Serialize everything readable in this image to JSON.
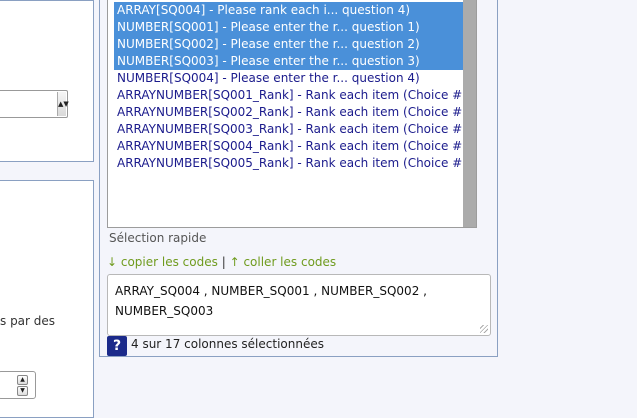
{
  "column_list": {
    "items": [
      {
        "label": "ARRAY[SQ004] - Please rank each i... question 4)",
        "selected": true
      },
      {
        "label": "NUMBER[SQ001] - Please enter the r... question 1)",
        "selected": true
      },
      {
        "label": "NUMBER[SQ002] - Please enter the r... question 2)",
        "selected": true
      },
      {
        "label": "NUMBER[SQ003] - Please enter the r... question 3)",
        "selected": true
      },
      {
        "label": "NUMBER[SQ004] - Please enter the r... question 4)",
        "selected": false
      },
      {
        "label": "ARRAYNUMBER[SQ001_Rank] - Rank each item (Choice #",
        "selected": false
      },
      {
        "label": "ARRAYNUMBER[SQ002_Rank] - Rank each item (Choice #",
        "selected": false
      },
      {
        "label": "ARRAYNUMBER[SQ003_Rank] - Rank each item (Choice #",
        "selected": false
      },
      {
        "label": "ARRAYNUMBER[SQ004_Rank] - Rank each item (Choice #",
        "selected": false
      },
      {
        "label": "ARRAYNUMBER[SQ005_Rank] - Rank each item (Choice #",
        "selected": false
      }
    ]
  },
  "quick_selection": {
    "label": "Sélection rapide",
    "copy_link": "↓ copier les codes",
    "separator": "|",
    "paste_link": "↑ coller les codes",
    "codes_value": "ARRAY_SQ004 , NUMBER_SQ001 , NUMBER_SQ002 , NUMBER_SQ003"
  },
  "help": {
    "icon_glyph": "?"
  },
  "status": {
    "selected_count_text": "4 sur 17 colonnes sélectionnées"
  },
  "left_panel": {
    "partial_text": "s par des"
  },
  "colors": {
    "selection": "#4a90d9",
    "link": "#6f9b1e",
    "help_icon": "#1b2a8a",
    "item_text": "#1b1b8c"
  }
}
